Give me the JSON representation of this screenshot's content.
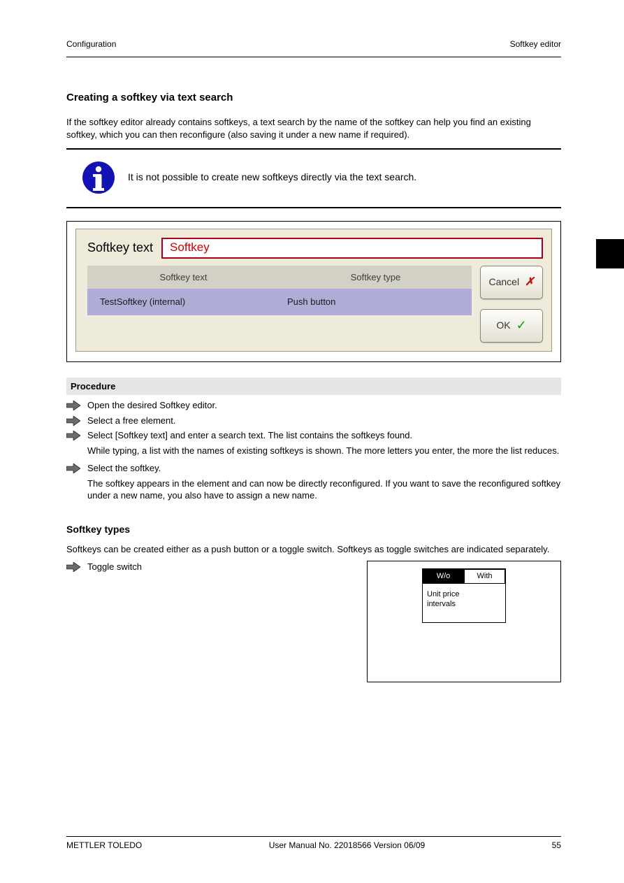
{
  "header": {
    "left": "Configuration",
    "right": "Softkey editor"
  },
  "section_title": "Creating a softkey via text search",
  "intro_para": "If the softkey editor already contains softkeys, a text search by the name of the softkey can help you find an existing softkey, which you can then reconfigure (also saving it under a new name if required).",
  "info": "It is not possible to create new softkeys directly via the text search.",
  "dialog": {
    "label": "Softkey text",
    "input_value": "Softkey",
    "columns": {
      "c1": "Softkey text",
      "c2": "Softkey type"
    },
    "row": {
      "c1": "TestSoftkey (internal)",
      "c2": "Push button"
    },
    "buttons": {
      "cancel": "Cancel",
      "ok": "OK"
    }
  },
  "proc_title": "Procedure",
  "steps": [
    "Open the desired Softkey editor.",
    "Select a free element.",
    "Select [Softkey text] and enter a search text. The list contains the softkeys found.",
    "Select the softkey."
  ],
  "step_note1": "While typing, a list with the names of existing softkeys is shown. The more letters you enter, the more the list reduces.",
  "step_note2": "The softkey appears in the element and can now be directly reconfigured. If you want to save the reconfigured softkey under a new name, you also have to assign a new name.",
  "sub_title": "Softkey types",
  "sub_text": "Softkeys can be created either as a push button or a toggle switch. Softkeys as toggle switches are indicated separately.",
  "toggle_step": "Toggle switch",
  "toggle": {
    "wo": "W/o",
    "with": "With",
    "body1": "Unit price",
    "body2": "intervals"
  },
  "footer": {
    "left": "METTLER TOLEDO",
    "center": "User Manual No. 22018566 Version 06/09",
    "right": "55"
  }
}
